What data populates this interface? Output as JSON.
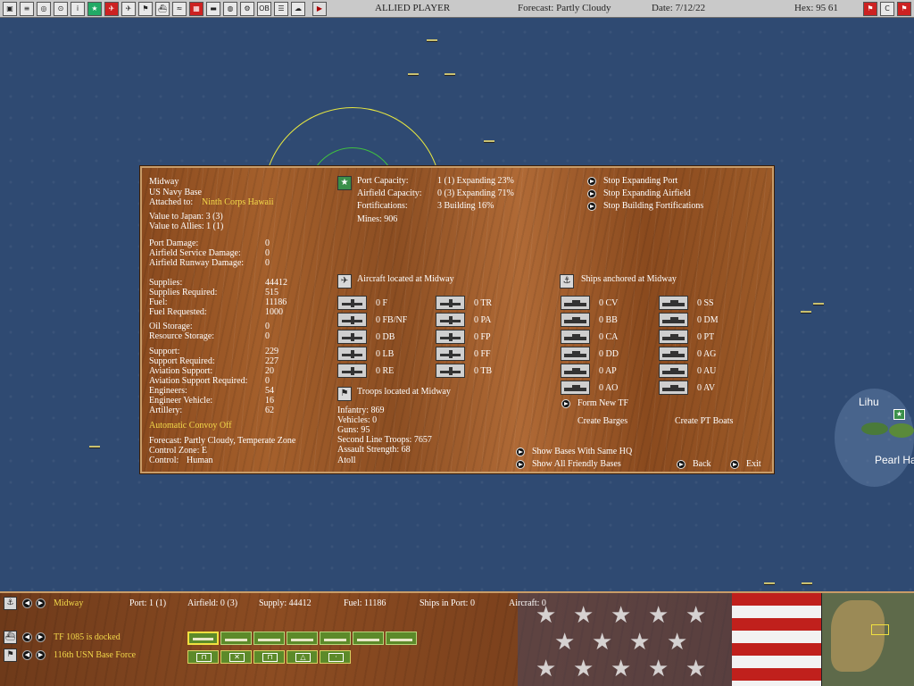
{
  "topbar": {
    "player": "ALLIED PLAYER",
    "forecast": "Forecast: Partly Cloudy",
    "date": "Date: 7/12/22",
    "hex": "Hex: 95 61",
    "close_label": "C"
  },
  "map": {
    "labels": {
      "lihu": "Lihu",
      "pearl": "Pearl Ha"
    }
  },
  "base": {
    "name": "Midway",
    "type": "US Navy Base",
    "attached_label": "Attached to:",
    "attached_value": "Ninth Corps Hawaii",
    "value_japan": "Value to Japan: 3 (3)",
    "value_allies": "Value to Allies: 1 (1)",
    "damage": [
      {
        "label": "Port Damage:",
        "value": "0"
      },
      {
        "label": "Airfield Service Damage:",
        "value": "0"
      },
      {
        "label": "Airfield Runway Damage:",
        "value": "0"
      }
    ],
    "supplies": [
      {
        "label": "Supplies:",
        "value": "44412"
      },
      {
        "label": "Supplies Required:",
        "value": "515"
      },
      {
        "label": "Fuel:",
        "value": "11186"
      },
      {
        "label": "Fuel Requested:",
        "value": "1000"
      }
    ],
    "storage": [
      {
        "label": "Oil Storage:",
        "value": "0"
      },
      {
        "label": "Resource Storage:",
        "value": "0"
      }
    ],
    "support": [
      {
        "label": "Support:",
        "value": "229"
      },
      {
        "label": "Support Required:",
        "value": "227"
      },
      {
        "label": "Aviation Support:",
        "value": "20"
      },
      {
        "label": "Aviation Support Required:",
        "value": "0"
      },
      {
        "label": "Engineers:",
        "value": "54"
      },
      {
        "label": "Engineer Vehicle:",
        "value": "16"
      },
      {
        "label": "Artillery:",
        "value": "62"
      }
    ],
    "convoy": "Automatic Convoy Off",
    "forecast": "Forecast: Partly Cloudy, Temperate Zone",
    "control_zone": "Control Zone: E",
    "control_label": "Control:",
    "control_value": "Human"
  },
  "capacity": {
    "port_label": "Port Capacity:",
    "port_value": "1 (1) Expanding 23%",
    "airfield_label": "Airfield Capacity:",
    "airfield_value": "0 (3) Expanding 71%",
    "forts_label": "Fortifications:",
    "forts_value": "3 Building 16%",
    "mines": "Mines: 906"
  },
  "actions": {
    "stop_port": "Stop Expanding Port",
    "stop_airfield": "Stop Expanding Airfield",
    "stop_forts": "Stop Building Fortifications",
    "form_tf": "Form New TF",
    "create_barges": "Create Barges",
    "create_pt": "Create PT Boats",
    "same_hq": "Show Bases With Same HQ",
    "all_friendly": "Show All Friendly Bases",
    "back": "Back",
    "exit": "Exit"
  },
  "aircraft": {
    "header": "Aircraft located at Midway",
    "left": [
      "0 F",
      "0 FB/NF",
      "0 DB",
      "0 LB",
      "0 RE"
    ],
    "right": [
      "0 TR",
      "0 PA",
      "0 FP",
      "0 FF",
      "0 TB"
    ]
  },
  "ships": {
    "header": "Ships anchored at Midway",
    "left": [
      "0 CV",
      "0 BB",
      "0 CA",
      "0 DD",
      "0 AP",
      "0 AO"
    ],
    "right": [
      "0 SS",
      "0 DM",
      "0 PT",
      "0 AG",
      "0 AU",
      "0 AV"
    ]
  },
  "troops": {
    "header": "Troops located at Midway",
    "lines": [
      "Infantry: 869",
      "Vehicles: 0",
      "Guns: 95",
      "Second Line Troops: 7657",
      "Assault Strength: 68",
      "Atoll"
    ]
  },
  "bottom": {
    "base_name": "Midway",
    "port": "Port: 1 (1)",
    "airfield": "Airfield: 0 (3)",
    "supply": "Supply: 44412",
    "fuel": "Fuel: 11186",
    "ships_in_port": "Ships in Port: 0",
    "aircraft": "Aircraft: 0",
    "tf": "TF 1085 is docked",
    "unit": "116th USN Base Force"
  },
  "colors": {
    "accent_yellow": "#f3d94a",
    "sea": "#2f4a72",
    "wood": "#9c5a28"
  }
}
